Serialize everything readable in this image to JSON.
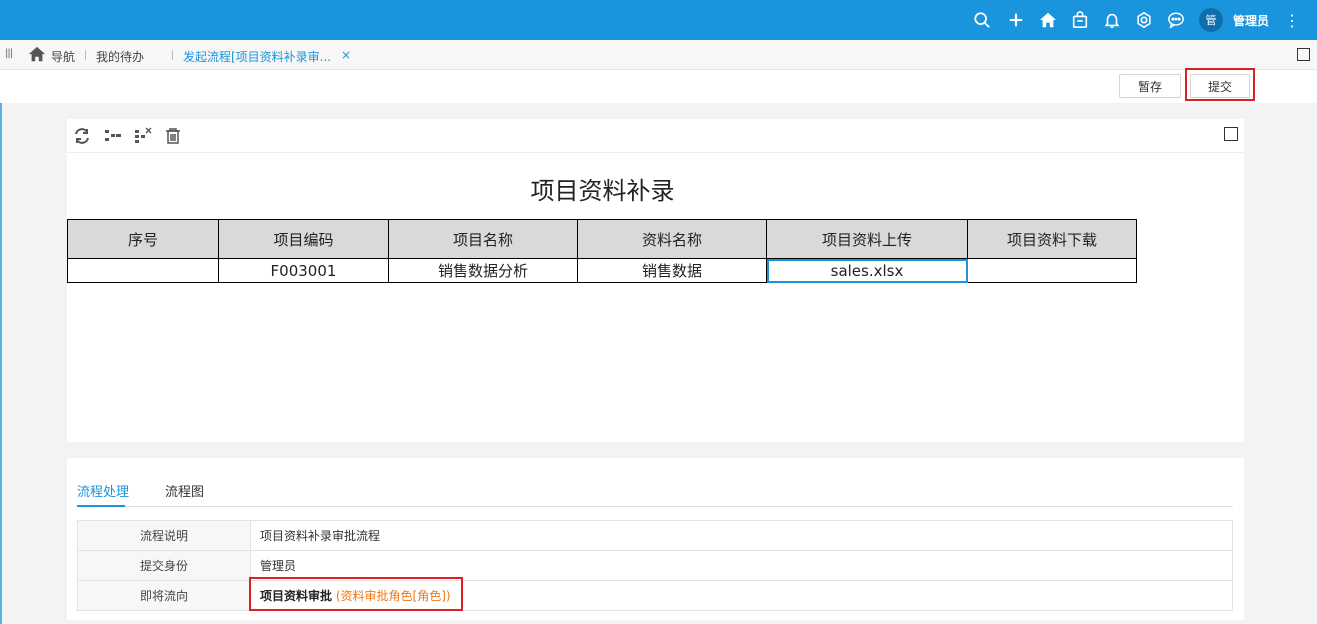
{
  "topbar": {
    "icons": [
      "search-icon",
      "plus-icon",
      "home-icon",
      "bag-icon",
      "bell-icon",
      "settings-icon",
      "message-icon"
    ],
    "avatar_text": "管",
    "username": "管理员",
    "bg_color": "#1a94dc"
  },
  "tabbar": {
    "nav_label": "导航",
    "todo_label": "我的待办",
    "active_tab_label": "发起流程[项目资料补录审...",
    "close_glyph": "×"
  },
  "actions": {
    "save_label": "暂存",
    "submit_label": "提交"
  },
  "form": {
    "title": "项目资料补录",
    "columns": [
      "序号",
      "项目编码",
      "项目名称",
      "资料名称",
      "项目资料上传",
      "项目资料下载"
    ],
    "rows": [
      {
        "seq": "",
        "code": "F003001",
        "name": "销售数据分析",
        "material": "销售数据",
        "upload": "sales.xlsx",
        "download": ""
      }
    ]
  },
  "flow": {
    "tabs": [
      "流程处理",
      "流程图"
    ],
    "active_tab": "流程处理",
    "rows": [
      {
        "key": "流程说明",
        "value": "项目资料补录审批流程"
      },
      {
        "key": "提交身份",
        "value": "管理员"
      },
      {
        "key": "即将流向",
        "value": "项目资料审批",
        "role": "(资料审批角色[角色])"
      }
    ]
  },
  "colors": {
    "accent": "#1a94dc",
    "highlight": "#e02020",
    "role_text": "#f07818"
  }
}
